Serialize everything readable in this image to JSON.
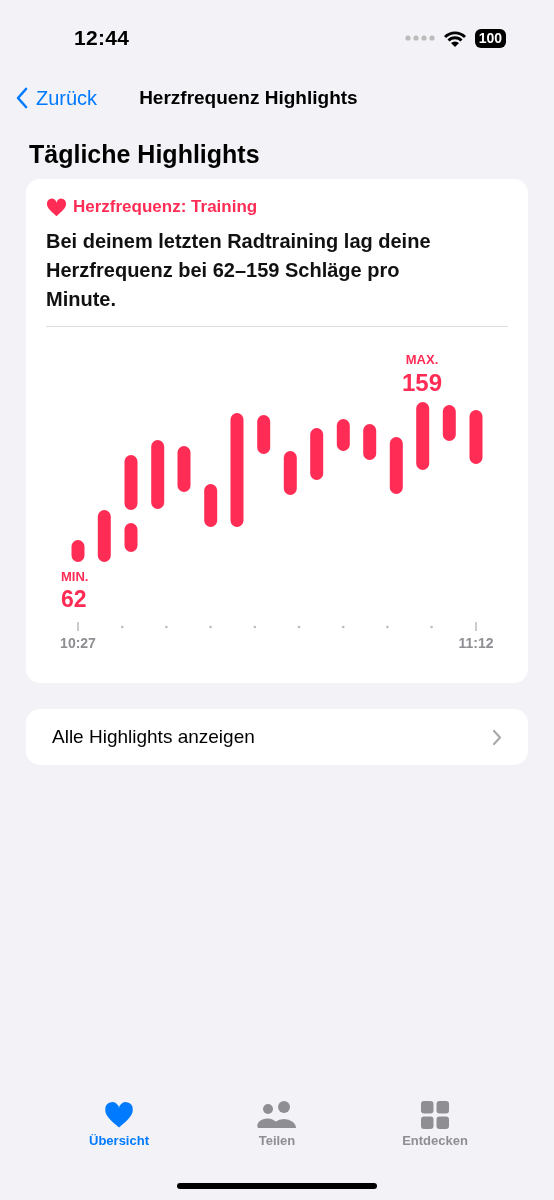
{
  "status_bar": {
    "time": "12:44",
    "battery": "100"
  },
  "nav": {
    "back": "Zurück",
    "title": "Herzfrequenz Highlights"
  },
  "section_title": "Tägliche Highlights",
  "highlight": {
    "category": "Herzfrequenz: Training",
    "text": "Bei deinem letzten Radtraining lag deine Herzfrequenz bei 62–159 Schläge pro Minute.",
    "chart": {
      "min_label": "MIN.",
      "min_value": "62",
      "max_label": "MAX.",
      "max_value": "159",
      "start_time": "10:27",
      "end_time": "11:12"
    }
  },
  "show_all": "Alle Highlights anzeigen",
  "tabs": [
    {
      "label": "Übersicht",
      "kind": "heart",
      "selected": true
    },
    {
      "label": "Teilen",
      "kind": "people",
      "selected": false
    },
    {
      "label": "Entdecken",
      "kind": "grid",
      "selected": false
    }
  ]
}
